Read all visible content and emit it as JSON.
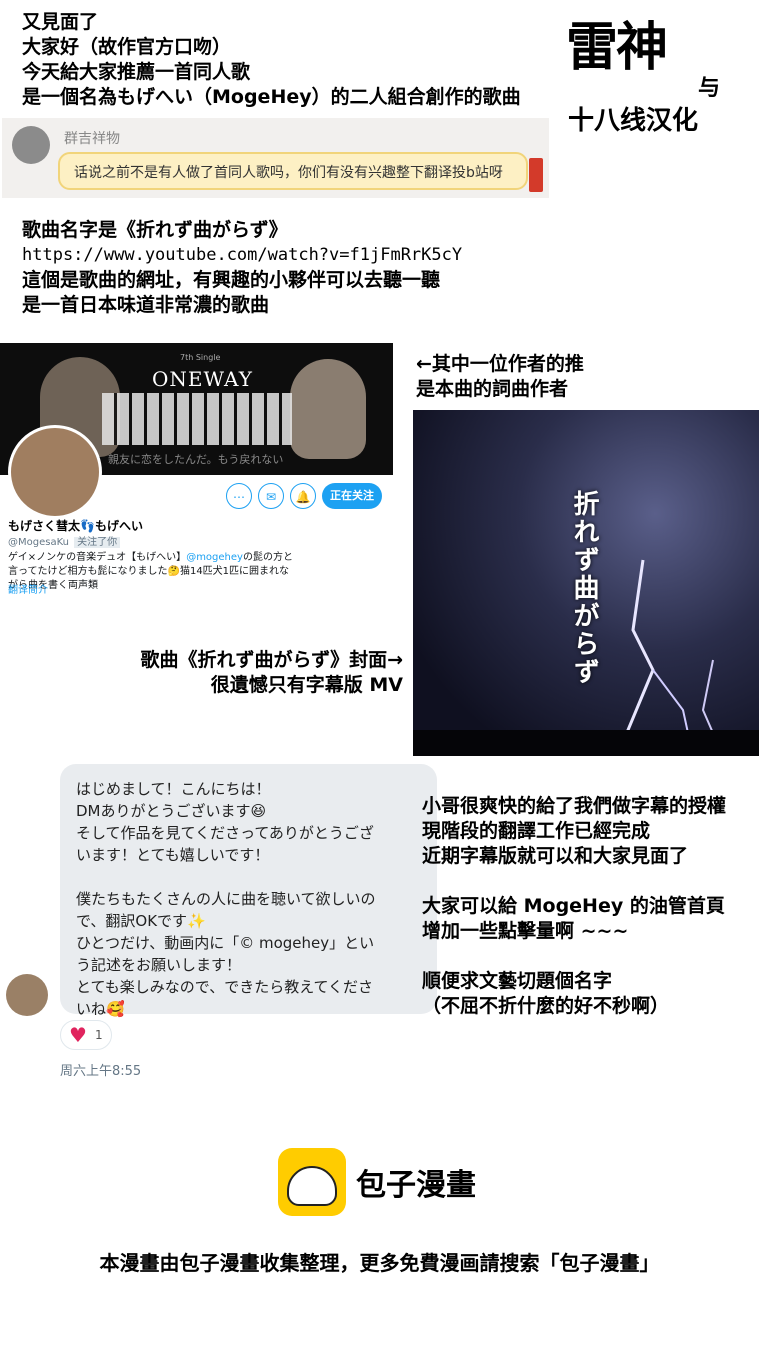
{
  "intro": {
    "lines": [
      "又見面了",
      "大家好（故作官方口吻）",
      "今天給大家推薦一首同人歌",
      "是一個名為もげへい（MogeHey）的二人組合創作的歌曲"
    ]
  },
  "logo": {
    "big1": "雷神",
    "small1": "与",
    "line2": "十八线汉化"
  },
  "chat_screenshot": {
    "sender": "群吉祥物",
    "message": "话说之前不是有人做了首同人歌吗，你们有没有兴趣整下翻译投b站呀"
  },
  "song": {
    "name_line": "歌曲名字是《折れず曲がらず》",
    "url": "https://www.youtube.com/watch?v=f1jFmRrK5cY",
    "line3": "這個是歌曲的網址，有興趣的小夥伴可以去聽一聽",
    "line4": "是一首日本味道非常濃的歌曲"
  },
  "twitter": {
    "banner_small": "7th Single",
    "banner_title": "ONEWAY",
    "banner_tagline": "親友に恋をしたんだ。もう戻れない",
    "btn_more": "⋯",
    "btn_mail": "✉",
    "btn_bell": "🔔",
    "follow_label": "正在关注",
    "display_name": "もげさく彗太👣もげへい",
    "handle": "@MogesaKu",
    "follows_you": "关注了你",
    "bio_part1": "ゲイ×ノンケの音楽デュオ【もげへい】",
    "bio_link": "@mogehey",
    "bio_part2": "の髭の方と言ってたけど相方も髭になりました🤔猫14匹犬1匹に囲まれながら曲を書く両声類",
    "translate": "翻译简介"
  },
  "right_note": {
    "line1": "←其中一位作者的推",
    "line2": "是本曲的詞曲作者"
  },
  "cover": {
    "title": "折れず曲がらず"
  },
  "cover_caption": {
    "line1": "歌曲《折れず曲がらず》封面→",
    "line2": "很遺憾只有字幕版 MV"
  },
  "dm": {
    "l1": "はじめまして！こんにちは！",
    "l2": "DMありがとうございます😆",
    "l3": "そして作品を見てくださってありがとうござ",
    "l4": "います！とても嬉しいです！",
    "l5": "僕たちもたくさんの人に曲を聴いて欲しいの",
    "l6": "で、翻訳OKです✨",
    "l7": "ひとつだけ、動画内に「© mogehey」とい",
    "l8": "う記述をお願いします！",
    "l9": "とても楽しみなので、できたら教えてくださ",
    "l10": "いね🥰",
    "likes": "1",
    "time": "周六上午8:55"
  },
  "note2": {
    "l1": "小哥很爽快的給了我們做字幕的授權",
    "l2": "現階段的翻譯工作已經完成",
    "l3": "近期字幕版就可以和大家見面了",
    "l4": "大家可以給 MogeHey 的油管首頁",
    "l5": "增加一些點擊量啊 ~~~",
    "l6": "順便求文藝切題個名字",
    "l7": "（不屈不折什麼的好不秒啊）"
  },
  "footer": {
    "brand": "包子漫畫",
    "text": "本漫畫由包子漫畫收集整理，更多免費漫画請搜索「包子漫畫」"
  }
}
